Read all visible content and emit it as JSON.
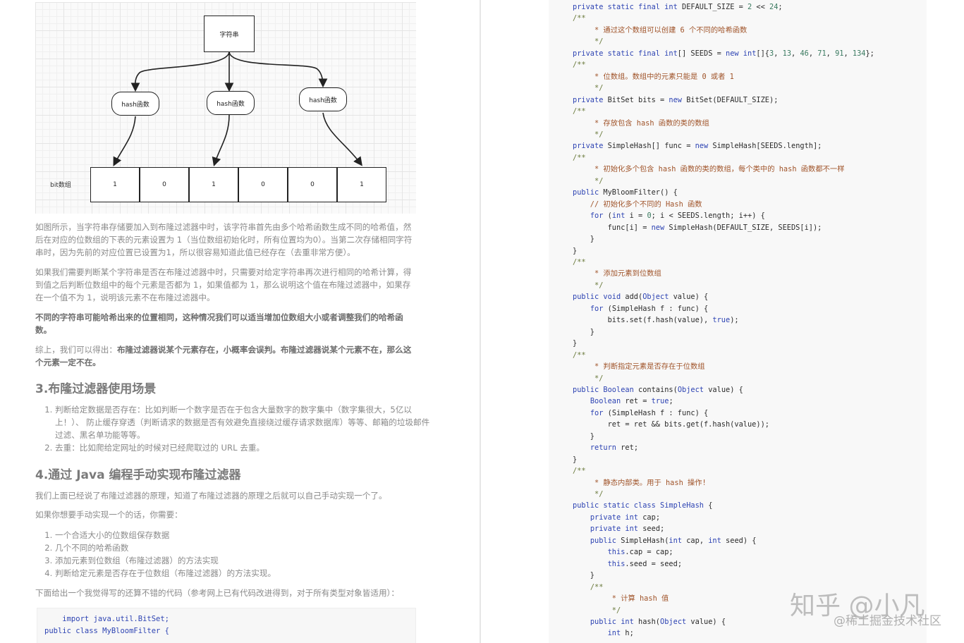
{
  "diagram": {
    "top_label": "字符串",
    "hash_labels": [
      "hash函数",
      "hash函数",
      "hash函数"
    ],
    "array_label": "bit数组",
    "cells": [
      "1",
      "0",
      "1",
      "0",
      "0",
      "1"
    ]
  },
  "left": {
    "p1": "如图所示，当字符串存储要加入到布隆过滤器中时，该字符串首先由多个哈希函数生成不同的哈希值，然后在对应的位数组的下表的元素设置为 1（当位数组初始化时，所有位置均为0）。当第二次存储相同字符串时，因为先前的对应位置已设置为1，所以很容易知道此值已经存在（去重非常方便）。",
    "p2": "如果我们需要判断某个字符串是否在布隆过滤器中时，只需要对给定字符串再次进行相同的哈希计算，得到值之后判断位数组中的每个元素是否都为 1，如果值都为 1，那么说明这个值在布隆过滤器中，如果存在一个值不为 1，说明该元素不在布隆过滤器中。",
    "p3": "不同的字符串可能哈希出来的位置相同，这种情况我们可以适当增加位数组大小或者调整我们的哈希函数。",
    "p4_prefix": "综上，我们可以得出：",
    "p4_bold": "布隆过滤器说某个元素存在，小概率会误判。布隆过滤器说某个元素不在，那么这个元素一定不在。",
    "h3_1": "3.布隆过滤器使用场景",
    "list1": [
      "判断给定数据是否存在：比如判断一个数字是否在于包含大量数字的数字集中（数字集很大，5亿以上！）、 防止缓存穿透（判断请求的数据是否有效避免直接绕过缓存请求数据库）等等、邮箱的垃圾邮件过滤、黑名单功能等等。",
      "去重：比如爬给定网址的时候对已经爬取过的 URL 去重。"
    ],
    "h3_2": "4.通过 Java 编程手动实现布隆过滤器",
    "p5": "我们上面已经说了布隆过滤器的原理，知道了布隆过滤器的原理之后就可以自己手动实现一个了。",
    "p6": "如果你想要手动实现一个的话，你需要：",
    "list2": [
      "一个合适大小的位数组保存数据",
      "几个不同的哈希函数",
      "添加元素到位数组（布隆过滤器）的方法实现",
      "判断给定元素是否存在于位数组（布隆过滤器）的方法实现。"
    ],
    "p7": "下面给出一个我觉得写的还算不错的代码（参考网上已有代码改进得到，对于所有类型对象皆适用）：",
    "code_l1": "    import java.util.BitSet;",
    "code_l2": "public class MyBloomFilter {"
  },
  "watermark": {
    "main": "知乎 @小凡",
    "sub": "@稀土掘金技术社区"
  }
}
